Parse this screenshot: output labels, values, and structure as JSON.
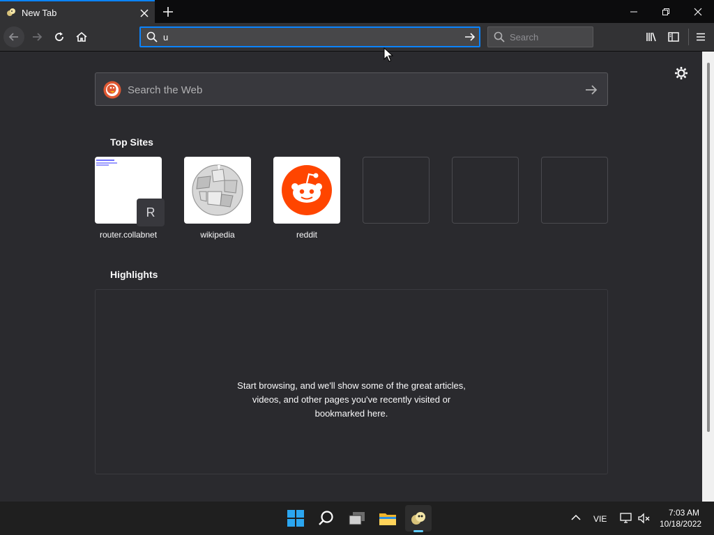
{
  "tab": {
    "title": "New Tab"
  },
  "urlbar": {
    "value": "u"
  },
  "searchbar": {
    "placeholder": "Search"
  },
  "content": {
    "web_search_placeholder": "Search the Web",
    "top_sites_title": "Top Sites",
    "top_sites": [
      {
        "label": "router.collabnet",
        "badge": "R"
      },
      {
        "label": "wikipedia"
      },
      {
        "label": "reddit"
      }
    ],
    "highlights_title": "Highlights",
    "highlights_message_1": "Start browsing, and we'll show some of the great articles,",
    "highlights_message_2": "videos, and other pages you've recently visited or",
    "highlights_message_3": "bookmarked here."
  },
  "taskbar": {
    "language": "VIE",
    "time": "7:03 AM",
    "date": "10/18/2022"
  },
  "colors": {
    "accent": "#0a84ff",
    "reddit": "#ff4500",
    "background": "#2a2a2e"
  }
}
